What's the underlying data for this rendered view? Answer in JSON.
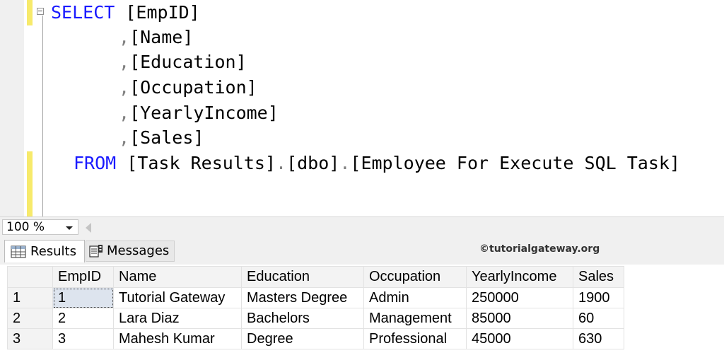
{
  "editor": {
    "keyword_select": "SELECT",
    "keyword_from": "FROM",
    "col_empid": "[EmpID]",
    "comma": ",",
    "dot": ".",
    "col_name": "[Name]",
    "col_education": "[Education]",
    "col_occupation": "[Occupation]",
    "col_yearlyincome": "[YearlyIncome]",
    "col_sales": "[Sales]",
    "db": "[Task Results]",
    "schema": "[dbo]",
    "table": "[Employee For Execute SQL Task]"
  },
  "zoom": {
    "value": "100 %"
  },
  "tabs": {
    "results": "Results",
    "messages": "Messages"
  },
  "watermark": "©tutorialgateway.org",
  "grid": {
    "columns": [
      "EmpID",
      "Name",
      "Education",
      "Occupation",
      "YearlyIncome",
      "Sales"
    ],
    "rows": [
      {
        "num": "1",
        "cells": [
          "1",
          "Tutorial Gateway",
          "Masters Degree",
          "Admin",
          "250000",
          "1900"
        ]
      },
      {
        "num": "2",
        "cells": [
          "2",
          "Lara Diaz",
          "Bachelors",
          "Management",
          "85000",
          "60"
        ]
      },
      {
        "num": "3",
        "cells": [
          "3",
          "Mahesh Kumar",
          "Degree",
          "Professional",
          "45000",
          "630"
        ]
      }
    ]
  },
  "colors": {
    "keyword": "#1a1aff",
    "change_bar": "#f7ea6b",
    "punctuation": "#808080"
  }
}
